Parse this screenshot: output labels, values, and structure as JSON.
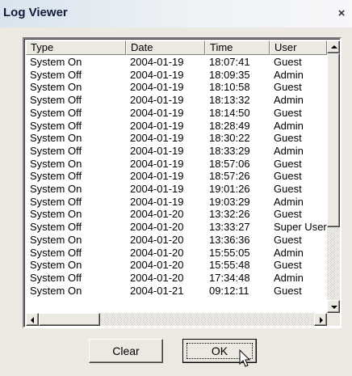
{
  "window": {
    "title": "Log Viewer",
    "close_label": "×"
  },
  "list": {
    "columns": [
      "Type",
      "Date",
      "Time",
      "User"
    ],
    "rows": [
      [
        "System On",
        "2004-01-19",
        "18:07:41",
        "Guest"
      ],
      [
        "System Off",
        "2004-01-19",
        "18:09:35",
        "Admin"
      ],
      [
        "System On",
        "2004-01-19",
        "18:10:58",
        "Guest"
      ],
      [
        "System Off",
        "2004-01-19",
        "18:13:32",
        "Admin"
      ],
      [
        "System Off",
        "2004-01-19",
        "18:14:50",
        "Guest"
      ],
      [
        "System Off",
        "2004-01-19",
        "18:28:49",
        "Admin"
      ],
      [
        "System On",
        "2004-01-19",
        "18:30:22",
        "Guest"
      ],
      [
        "System Off",
        "2004-01-19",
        "18:33:29",
        "Admin"
      ],
      [
        "System On",
        "2004-01-19",
        "18:57:06",
        "Guest"
      ],
      [
        "System Off",
        "2004-01-19",
        "18:57:26",
        "Guest"
      ],
      [
        "System On",
        "2004-01-19",
        "19:01:26",
        "Guest"
      ],
      [
        "System Off",
        "2004-01-19",
        "19:03:29",
        "Admin"
      ],
      [
        "System On",
        "2004-01-20",
        "13:32:26",
        "Guest"
      ],
      [
        "System Off",
        "2004-01-20",
        "13:33:27",
        "Super User"
      ],
      [
        "System On",
        "2004-01-20",
        "13:36:36",
        "Guest"
      ],
      [
        "System Off",
        "2004-01-20",
        "15:55:05",
        "Admin"
      ],
      [
        "System On",
        "2004-01-20",
        "15:55:48",
        "Guest"
      ],
      [
        "System Off",
        "2004-01-20",
        "17:34:48",
        "Admin"
      ],
      [
        "System On",
        "2004-01-21",
        "09:12:11",
        "Guest"
      ]
    ]
  },
  "buttons": {
    "clear_label": "Clear",
    "ok_label": "OK"
  }
}
